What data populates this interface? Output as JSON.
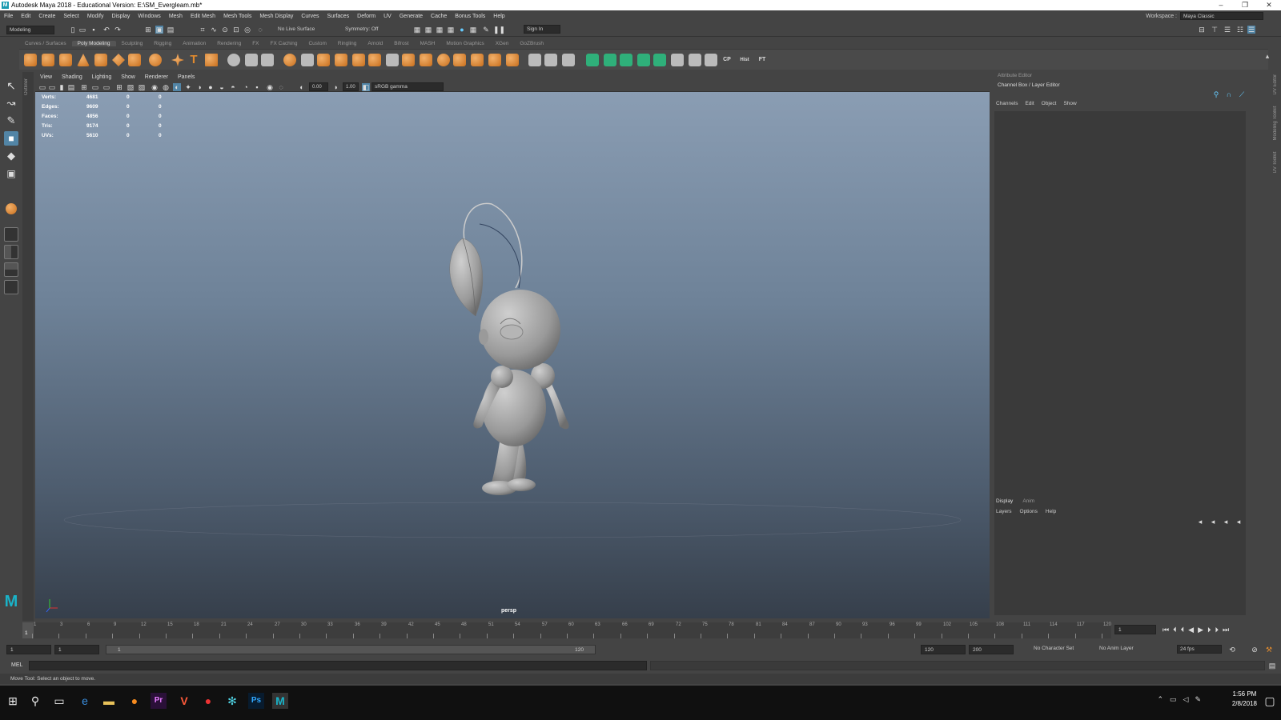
{
  "window": {
    "title": "Autodesk Maya 2018 - Educational Version: E:\\SM_Evergleam.mb*",
    "logo": "M",
    "minimize": "–",
    "restore": "❐",
    "close": "✕"
  },
  "menu": [
    "File",
    "Edit",
    "Create",
    "Select",
    "Modify",
    "Display",
    "Windows",
    "Mesh",
    "Edit Mesh",
    "Mesh Tools",
    "Mesh Display",
    "Curves",
    "Surfaces",
    "Deform",
    "UV",
    "Generate",
    "Cache",
    "Bonus Tools",
    "Help"
  ],
  "workspace": {
    "label": "Workspace :",
    "value": "Maya Classic"
  },
  "statusline": {
    "mode": "Modeling",
    "live_surface": "No Live Surface",
    "symmetry": "Symmetry: Off",
    "sign_in": "Sign In"
  },
  "shelf_tabs": [
    "Curves / Surfaces",
    "Poly Modeling",
    "Sculpting",
    "Rigging",
    "Animation",
    "Rendering",
    "FX",
    "FX Caching",
    "Custom",
    "Ringling",
    "Arnold",
    "Bifrost",
    "MASH",
    "Motion Graphics",
    "XGen",
    "GoZBrush"
  ],
  "shelf_active": "Poly Modeling",
  "shelf_labels": {
    "text": "T",
    "cp": "CP",
    "hist": "Hist",
    "ft": "FT"
  },
  "viewport_menu": [
    "View",
    "Shading",
    "Lighting",
    "Show",
    "Renderer",
    "Panels"
  ],
  "viewport_toolbar": {
    "near": "0.00",
    "far": "1.00",
    "color_space": "sRGB gamma"
  },
  "hud": [
    {
      "label": "Verts:",
      "a": "4681",
      "b": "0",
      "c": "0"
    },
    {
      "label": "Edges:",
      "a": "9609",
      "b": "0",
      "c": "0"
    },
    {
      "label": "Faces:",
      "a": "4856",
      "b": "0",
      "c": "0"
    },
    {
      "label": "Tris:",
      "a": "9174",
      "b": "0",
      "c": "0"
    },
    {
      "label": "UVs:",
      "a": "5610",
      "b": "0",
      "c": "0"
    }
  ],
  "camera_label": "persp",
  "outliner_label": "Outliner",
  "right_panel": {
    "attribute_editor": "Attribute Editor",
    "channel_box": "Channel Box / Layer Editor",
    "channel_tabs": [
      "Channels",
      "Edit",
      "Object",
      "Show"
    ],
    "layer_tabs": [
      "Display",
      "Anim"
    ],
    "layer_menu": [
      "Layers",
      "Options",
      "Help"
    ],
    "side_tabs": [
      "UV Toolkit",
      "Modeling Toolkit",
      "UV Editor"
    ]
  },
  "timeline": {
    "ticks": [
      "1",
      "3",
      "6",
      "9",
      "12",
      "15",
      "18",
      "21",
      "24",
      "27",
      "30",
      "33",
      "36",
      "39",
      "42",
      "45",
      "48",
      "51",
      "54",
      "57",
      "60",
      "63",
      "66",
      "69",
      "72",
      "75",
      "78",
      "81",
      "84",
      "87",
      "90",
      "93",
      "96",
      "99",
      "102",
      "105",
      "108",
      "111",
      "114",
      "117",
      "120"
    ],
    "current_frame": "1"
  },
  "range": {
    "start": "1",
    "playback_start": "1",
    "slider_left": "1",
    "slider_right": "120",
    "playback_end": "120",
    "end": "200",
    "character_set": "No Character Set",
    "anim_layer": "No Anim Layer",
    "fps": "24 fps"
  },
  "mel_label": "MEL",
  "help_line": "Move Tool: Select an object to move.",
  "taskbar": {
    "time": "1:56 PM",
    "date": "2/8/2018"
  }
}
